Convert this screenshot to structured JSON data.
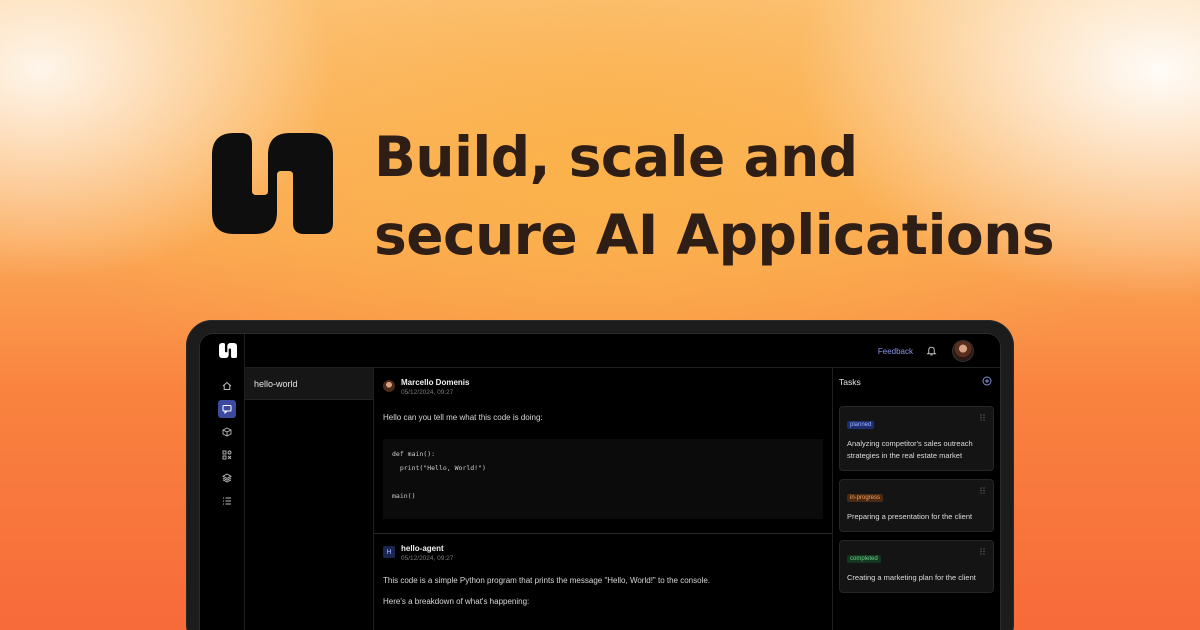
{
  "hero": {
    "title_line1": "Build, scale and",
    "title_line2": "secure AI Applications"
  },
  "rail": {
    "icons": [
      "home-icon",
      "chat-icon",
      "cube-icon",
      "shapes-icon",
      "layers-icon",
      "list-icon"
    ],
    "active_index": 1,
    "accent": "#3b4a9e"
  },
  "topbar": {
    "feedback_label": "Feedback"
  },
  "channels": {
    "items": [
      {
        "label": "hello-world"
      }
    ]
  },
  "messages": [
    {
      "author": "Marcello Domenis",
      "timestamp": "05/12/2024, 09:27",
      "text": "Hello can you tell me what this code is doing:",
      "code": "def main():\n  print(\"Hello, World!\")\n\nmain()"
    },
    {
      "author": "hello-agent",
      "avatar_letter": "H",
      "timestamp": "05/12/2024, 09:27",
      "text": "This code is a simple Python program that prints the message \"Hello, World!\" to the console.",
      "text2": "Here's a breakdown of what's happening:"
    }
  ],
  "tasks": {
    "title": "Tasks",
    "items": [
      {
        "status": "planned",
        "text": "Analyzing competitor's sales outreach strategies in the real estate market"
      },
      {
        "status": "in-progress",
        "text": "Preparing a presentation for the client"
      },
      {
        "status": "completed",
        "text": "Creating a marketing plan for the client"
      }
    ]
  },
  "colors": {
    "planned": "#9db2ff",
    "in_progress": "#f7a35c",
    "completed": "#6bd88a",
    "link": "#8a94e6"
  }
}
